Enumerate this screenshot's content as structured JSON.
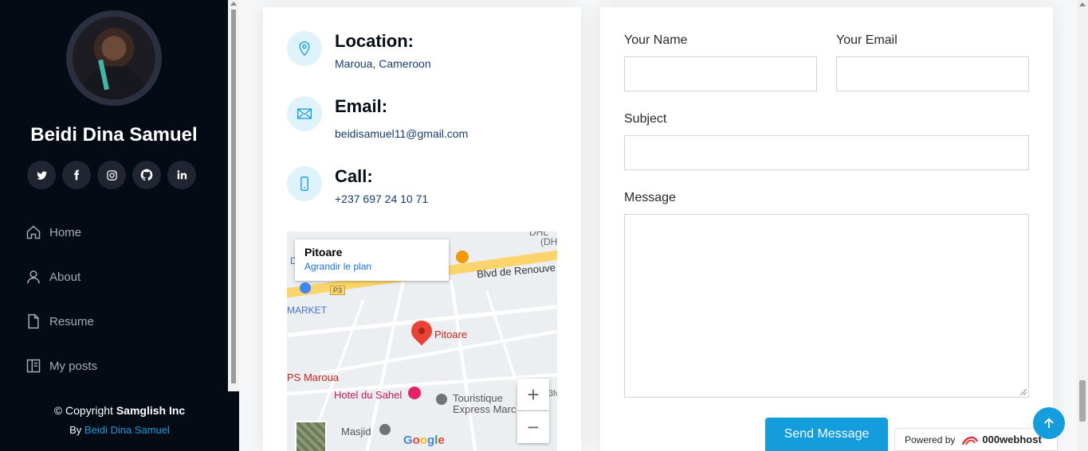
{
  "sidebar": {
    "name": "Beidi Dina Samuel",
    "socials": [
      {
        "icon": "twitter-icon",
        "glyph": "t"
      },
      {
        "icon": "facebook-icon",
        "glyph": "f"
      },
      {
        "icon": "instagram-icon",
        "glyph": "◎"
      },
      {
        "icon": "github-icon",
        "glyph": "◉"
      },
      {
        "icon": "linkedin-icon",
        "glyph": "in"
      }
    ],
    "nav": [
      {
        "label": "Home",
        "icon": "home-icon"
      },
      {
        "label": "About",
        "icon": "person-icon"
      },
      {
        "label": "Resume",
        "icon": "file-icon"
      },
      {
        "label": "My posts",
        "icon": "layout-icon"
      }
    ],
    "copyright_prefix": "© Copyright",
    "copyright_org": "Samglish Inc",
    "credit_prefix": "By",
    "credit_link": "Beidi Dina Samuel"
  },
  "info": {
    "location_title": "Location:",
    "location_text": "Maroua, Cameroon",
    "email_title": "Email:",
    "email_text": "beidisamuel11@gmail.com",
    "call_title": "Call:",
    "call_text": "+237 697 24 10 71"
  },
  "map": {
    "popup_title": "Pitoare",
    "popup_link": "Agrandir le plan",
    "road_label": "Blvd de Renouve",
    "road_badge": "P3",
    "market_label": "MARKET",
    "pin_label": "Pitoare",
    "ps_label": "PS Maroua",
    "hotel_label": "Hotel du Sahel",
    "touristique_label_1": "Touristique",
    "touristique_label_2": "Express Marc",
    "masjid_label": "Masjid",
    "top_label_1": "DHL",
    "top_label_2": "(DH",
    "side_label": "D",
    "edge_label": "3lv",
    "zoom_in": "+",
    "zoom_out": "−",
    "google": "Google"
  },
  "form": {
    "name_label": "Your Name",
    "email_label": "Your Email",
    "subject_label": "Subject",
    "message_label": "Message",
    "send_label": "Send Message"
  },
  "powered": {
    "prefix": "Powered by",
    "brand": "000webhost"
  },
  "colors": {
    "accent": "#149ddd",
    "sidebar_bg": "#040b14",
    "heading": "#050d18"
  }
}
